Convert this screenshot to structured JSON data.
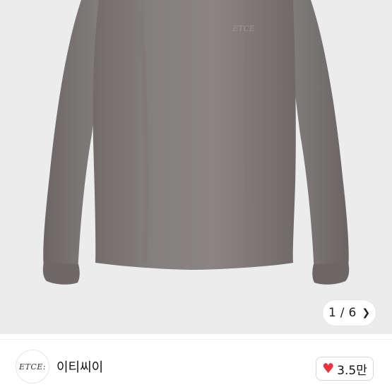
{
  "product": {
    "chest_logo_text": "ETCE",
    "image_alt": "Gray long sleeve t-shirt"
  },
  "gallery": {
    "current": "1",
    "separator": "/",
    "total": "6",
    "next_icon": "chevron-right-icon"
  },
  "shop": {
    "logo_text": "ETCE:",
    "name": "이티씨이"
  },
  "like": {
    "icon": "heart-icon",
    "count": "3.5만",
    "heart_color": "#e8343c"
  },
  "colors": {
    "background": "#ececec",
    "shirt": "#807a78"
  }
}
